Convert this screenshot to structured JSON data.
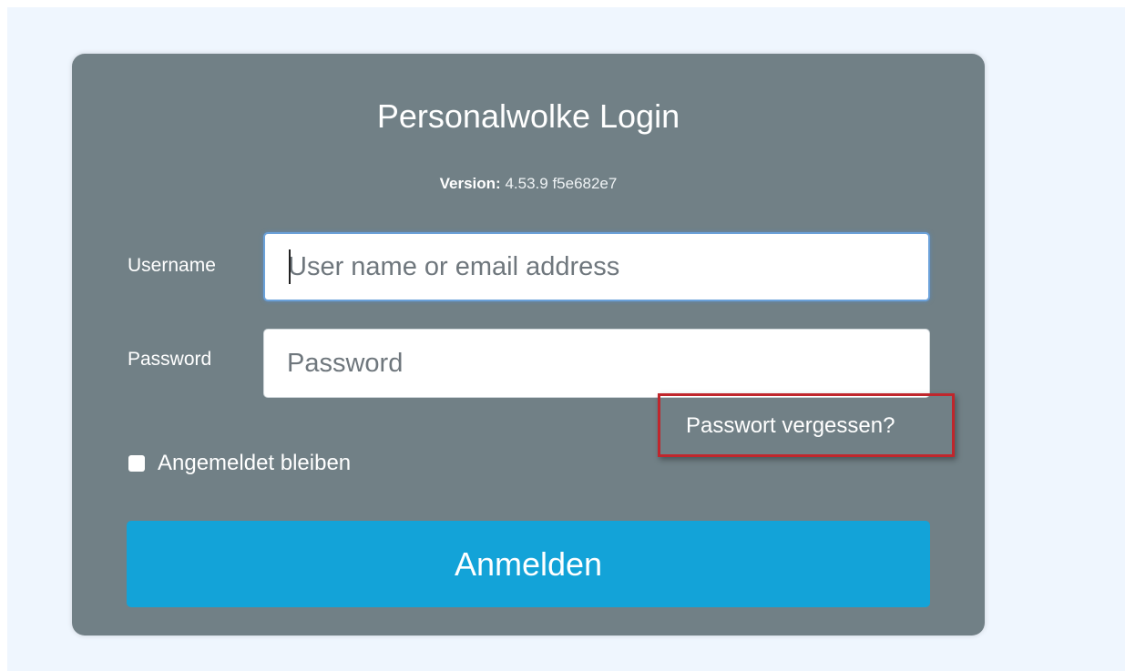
{
  "login": {
    "title": "Personalwolke Login",
    "version_label": "Version:",
    "version_value": "4.53.9 f5e682e7",
    "username_label": "Username",
    "username_placeholder": "User name or email address",
    "password_label": "Password",
    "password_placeholder": "Password",
    "forgot_link": "Passwort vergessen?",
    "remember_label": "Angemeldet bleiben",
    "remember_checked": false,
    "submit_label": "Anmelden"
  },
  "colors": {
    "page_background": "#eff6fe",
    "card_background": "#718086",
    "submit_button": "#13a3d8",
    "highlight_box": "#c0262c",
    "focus_border": "#6ba1d9"
  }
}
